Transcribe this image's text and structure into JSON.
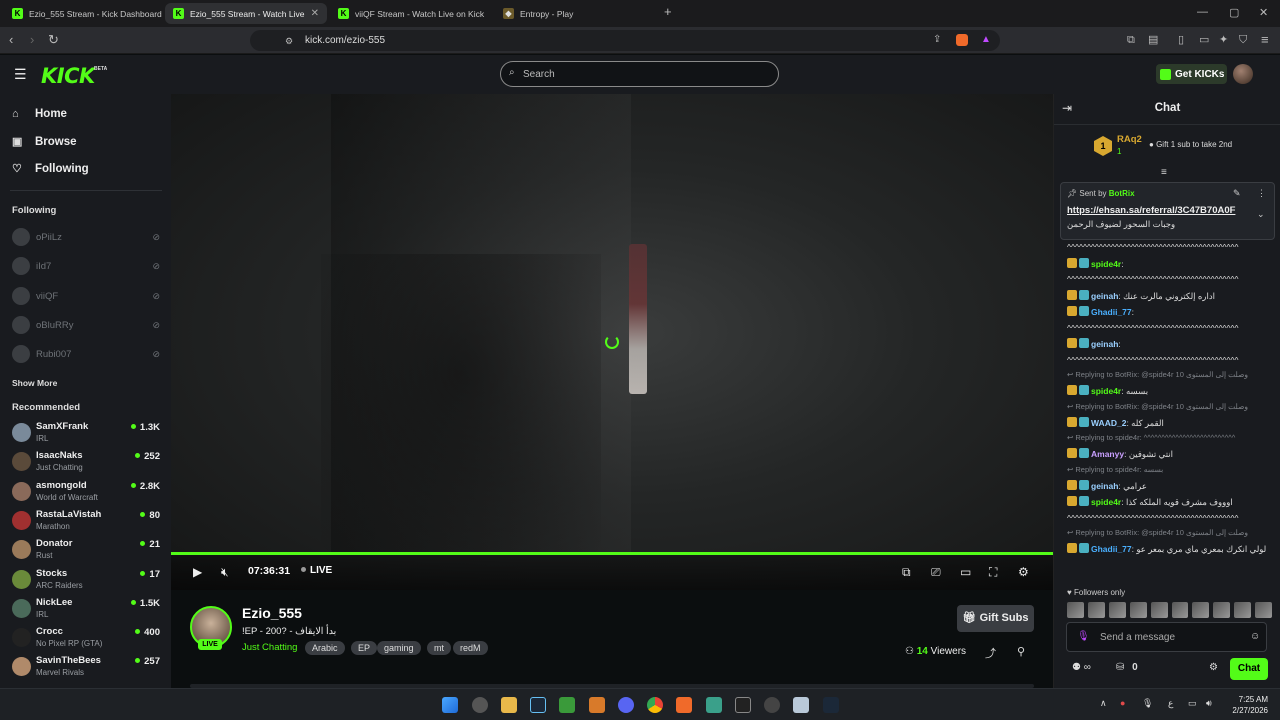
{
  "browser": {
    "tabs": [
      {
        "label": "Ezio_555 Stream - Kick Dashboard"
      },
      {
        "label": "Ezio_555 Stream - Watch Live on Kick"
      },
      {
        "label": "viiQF Stream - Watch Live on Kick"
      },
      {
        "label": "Entropy - Play"
      }
    ],
    "url": "kick.com/ezio-555"
  },
  "header": {
    "logo": "KICK",
    "beta": "BETA",
    "search_placeholder": "Search",
    "get_kicks": "Get KICKs"
  },
  "sidebar": {
    "nav": [
      {
        "label": "Home",
        "icon": "home-icon"
      },
      {
        "label": "Browse",
        "icon": "browse-icon"
      },
      {
        "label": "Following",
        "icon": "heart-icon"
      }
    ],
    "following_title": "Following",
    "following": [
      {
        "name": "oPiiLz"
      },
      {
        "name": "iId7"
      },
      {
        "name": "viiQF"
      },
      {
        "name": "oBluRRy"
      },
      {
        "name": "Rubi007"
      }
    ],
    "show_more": "Show More",
    "recommended_title": "Recommended",
    "recommended": [
      {
        "name": "SamXFrank",
        "category": "IRL",
        "viewers": "1.3K",
        "color": "#7a8a9a"
      },
      {
        "name": "IsaacNaks",
        "category": "Just Chatting",
        "viewers": "252",
        "color": "#5a4a3a"
      },
      {
        "name": "asmongold",
        "category": "World of Warcraft",
        "viewers": "2.8K",
        "color": "#8a6a5a"
      },
      {
        "name": "RastaLaVistah",
        "category": "Marathon",
        "viewers": "80",
        "color": "#a03030"
      },
      {
        "name": "Donator",
        "category": "Rust",
        "viewers": "21",
        "color": "#9a7a5a"
      },
      {
        "name": "Stocks",
        "category": "ARC Raiders",
        "viewers": "17",
        "color": "#6a8a3a"
      },
      {
        "name": "NickLee",
        "category": "IRL",
        "viewers": "1.5K",
        "color": "#4a6a5a"
      },
      {
        "name": "Crocc",
        "category": "No Pixel RP (GTA)",
        "viewers": "400",
        "color": "#222"
      },
      {
        "name": "SavinTheBees",
        "category": "Marvel Rivals",
        "viewers": "257",
        "color": "#b08a6a"
      }
    ]
  },
  "player": {
    "time": "07:36:31",
    "live": "LIVE"
  },
  "stream": {
    "channel": "Ezio_555",
    "live_badge": "LIVE",
    "title": "!EP - 200? - بدأ الايقاف",
    "category": "Just Chatting",
    "tags": [
      "Arabic",
      "EP",
      "gaming",
      "mt",
      "redM"
    ],
    "gift_subs": "Gift Subs",
    "viewers_count": "14",
    "viewers_label": "Viewers"
  },
  "chat": {
    "title": "Chat",
    "leader_name": "RAq2",
    "leader_count": "1",
    "leader_rank": "1",
    "gift_prompt": "Gift 1 sub to take 2nd",
    "pinned": {
      "sent_by": "Sent by",
      "bot": "BotRix",
      "link": "https://ehsan.sa/referral/3C47B70A0F",
      "text": "وجبات السحور لضيوف الرحمن"
    },
    "messages": [
      {
        "type": "text",
        "text": "^^^^^^^^^^^^^^^^^^^^^^^^^^^^^^^^^^^^^^^^^^^"
      },
      {
        "type": "msg",
        "user": "spide4r",
        "color": "#53fc18",
        "text": ""
      },
      {
        "type": "text",
        "text": "^^^^^^^^^^^^^^^^^^^^^^^^^^^^^^^^^^^^^^^^^^^"
      },
      {
        "type": "msg",
        "user": "geinah",
        "color": "#9ad0ff",
        "text": "اداره إلكتروني مالرت عنك"
      },
      {
        "type": "msg",
        "user": "Ghadii_77",
        "color": "#4ab0ff",
        "text": ""
      },
      {
        "type": "text",
        "text": "^^^^^^^^^^^^^^^^^^^^^^^^^^^^^^^^^^^^^^^^^^^"
      },
      {
        "type": "msg",
        "user": "geinah",
        "color": "#9ad0ff",
        "text": ""
      },
      {
        "type": "text",
        "text": "^^^^^^^^^^^^^^^^^^^^^^^^^^^^^^^^^^^^^^^^^^^"
      },
      {
        "type": "reply",
        "text": "Replying to BotRix: @spide4r 10 وصلت إلى المستوى"
      },
      {
        "type": "msg",
        "user": "spide4r",
        "color": "#53fc18",
        "text": "بسسه"
      },
      {
        "type": "reply",
        "text": "Replying to BotRix: @spide4r 10 وصلت إلى المستوى"
      },
      {
        "type": "msg",
        "user": "WAAD_2",
        "color": "#9ad0ff",
        "text": "القمر كله"
      },
      {
        "type": "reply",
        "text": "Replying to spide4r: ^^^^^^^^^^^^^^^^^^^^^^^^^^"
      },
      {
        "type": "msg",
        "user": "Amanyy",
        "color": "#c9a0ff",
        "text": "انتي تشوفين"
      },
      {
        "type": "reply",
        "text": "Replying to spide4r: بسسه"
      },
      {
        "type": "msg",
        "user": "geinah",
        "color": "#9ad0ff",
        "text": "عرامي"
      },
      {
        "type": "msg",
        "user": "spide4r",
        "color": "#53fc18",
        "text": "اوووف مشرف قويه الملكه كذا"
      },
      {
        "type": "text",
        "text": "^^^^^^^^^^^^^^^^^^^^^^^^^^^^^^^^^^^^^^^^^^^"
      },
      {
        "type": "reply",
        "text": "Replying to BotRix: @spide4r 10 وصلت إلى المستوى"
      },
      {
        "type": "msg",
        "user": "Ghadii_77",
        "color": "#4ab0ff",
        "text": "لولي انكرك بمعري ماي مري بمعر عو"
      }
    ],
    "followers_only": "Followers only",
    "input_placeholder": "Send a message",
    "points": "0",
    "send": "Chat"
  },
  "taskbar": {
    "time": "7:25 AM",
    "date": "2/27/2026"
  }
}
